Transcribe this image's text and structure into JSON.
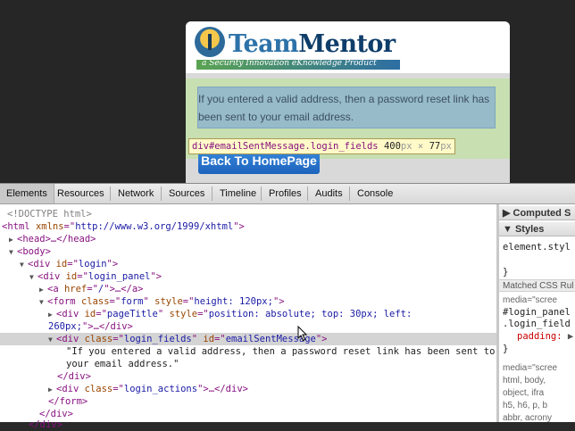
{
  "preview": {
    "logo": {
      "title_part1": "Team",
      "title_part2": "Mentor",
      "tagline": "a Security Innovation eKnowledge Product"
    },
    "email_sent_message": "If you entered a valid address, then a password reset link has been sent to your email address.",
    "home_button": "Back To HomePage",
    "inspect_tooltip": {
      "selector": "div#emailSentMessage.login_fields",
      "width": "400",
      "height": "77",
      "unit": "px",
      "times": "×"
    }
  },
  "devtools": {
    "tabs": [
      "Elements",
      "Resources",
      "Network",
      "Sources",
      "Timeline",
      "Profiles",
      "Audits",
      "Console"
    ],
    "active_tab": "Elements",
    "dom": {
      "doctype": "<!DOCTYPE html>",
      "html_xmlns": "http://www.w3.org/1999/xhtml",
      "head_collapsed": "<head>…</head>",
      "div_login_id": "login",
      "div_login_panel_id": "login_panel",
      "a_href": "/",
      "form_class": "form",
      "form_style": "height: 120px;",
      "pagetitle_id": "pageTitle",
      "pagetitle_style": "position: absolute; top: 30px; left:",
      "pagetitle_style_cont": "260px;",
      "selected_class": "login_fields",
      "selected_id": "emailSentMessage",
      "text_line1": "\"If you entered a valid address, then a password reset link has been sent to",
      "text_line2": "your email address.\"",
      "actions_class": "login_actions"
    },
    "side": {
      "computed": "Computed S",
      "styles": "Styles",
      "element_style": "element.styl",
      "matched_css": "Matched CSS Rul",
      "rule1_media": "media=\"scree",
      "rule1_selector1": "#login_panel",
      "rule1_selector2": ".login_field",
      "rule1_prop": "padding:",
      "rule2_media": "media=\"scree",
      "rule2_line1": "html, body,",
      "rule2_line2": "object, ifra",
      "rule2_line3": "h5, h6, p, b",
      "rule2_line4": "abbr, acrony"
    }
  }
}
